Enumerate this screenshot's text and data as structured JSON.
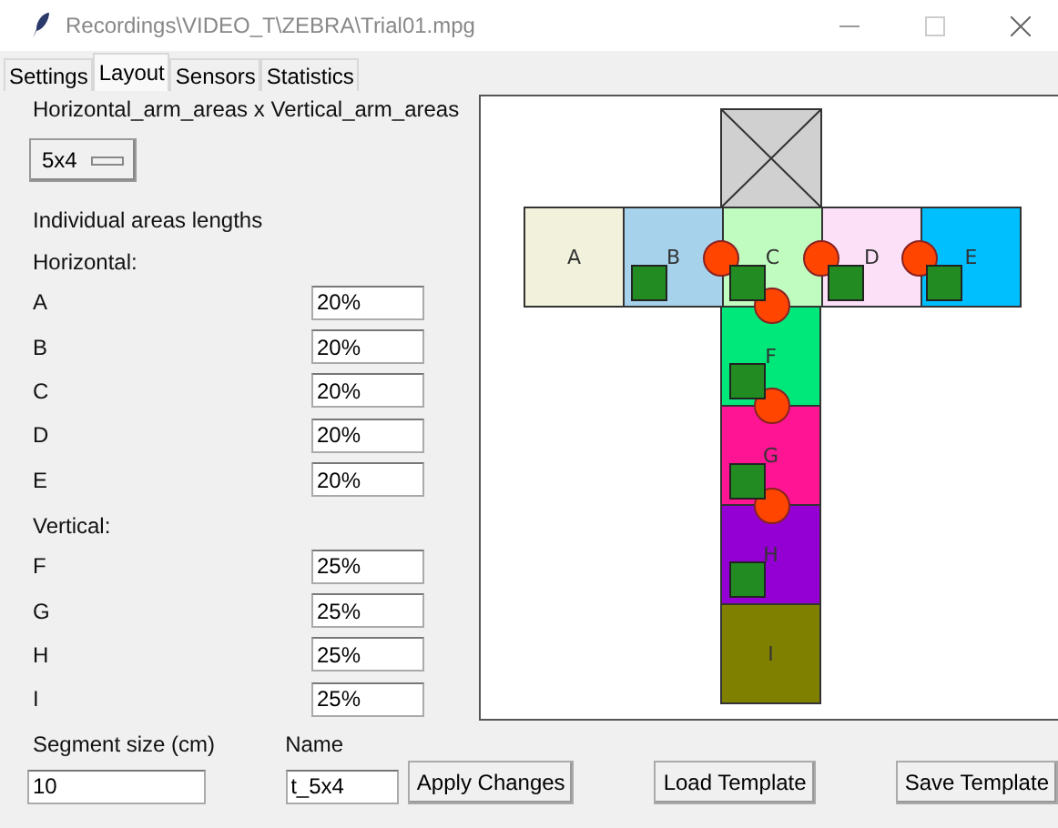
{
  "window": {
    "title": "Recordings\\VIDEO_T\\ZEBRA\\Trial01.mpg"
  },
  "tabs": [
    {
      "label": "Settings",
      "selected": false
    },
    {
      "label": "Layout",
      "selected": true
    },
    {
      "label": "Sensors",
      "selected": false
    },
    {
      "label": "Statistics",
      "selected": false
    }
  ],
  "arrangement": {
    "label": "Horizontal_arm_areas x Vertical_arm_areas",
    "value": "5x4"
  },
  "lengths_heading": "Individual areas lengths",
  "horizontal": {
    "label": "Horizontal:",
    "fields": [
      {
        "label": "A",
        "value": "20%"
      },
      {
        "label": "B",
        "value": "20%"
      },
      {
        "label": "C",
        "value": "20%"
      },
      {
        "label": "D",
        "value": "20%"
      },
      {
        "label": "E",
        "value": "20%"
      }
    ]
  },
  "vertical": {
    "label": "Vertical:",
    "fields": [
      {
        "label": "F",
        "value": "25%"
      },
      {
        "label": "G",
        "value": "25%"
      },
      {
        "label": "H",
        "value": "25%"
      },
      {
        "label": "I",
        "value": "25%"
      }
    ]
  },
  "segment_size": {
    "label": "Segment size (cm)",
    "value": "10"
  },
  "name": {
    "label": "Name",
    "value": "t_5x4"
  },
  "buttons": [
    "Apply Changes",
    "Load Template",
    "Save Template"
  ],
  "diagram": {
    "arms": [
      {
        "label": "A",
        "color": "#f2f2dc"
      },
      {
        "label": "B",
        "color": "#a6d2ec"
      },
      {
        "label": "C",
        "color": "#c0fcc0"
      },
      {
        "label": "D",
        "color": "#fce0f8"
      },
      {
        "label": "E",
        "color": "#00bfff"
      },
      {
        "label": "F",
        "color": "#00e87a"
      },
      {
        "label": "G",
        "color": "#ff1493"
      },
      {
        "label": "H",
        "color": "#9400d3"
      },
      {
        "label": "I",
        "color": "#808000"
      }
    ]
  }
}
